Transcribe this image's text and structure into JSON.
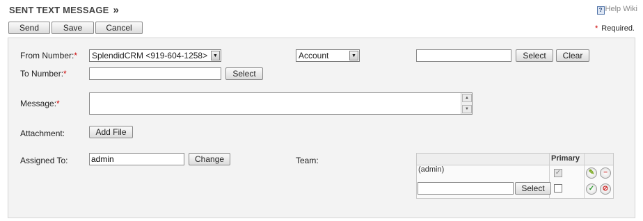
{
  "header": {
    "title": "SENT TEXT MESSAGE",
    "chevron": "»",
    "help_label": "Help Wiki",
    "help_icon": "?"
  },
  "toolbar": {
    "send_label": "Send",
    "save_label": "Save",
    "cancel_label": "Cancel"
  },
  "required_note": {
    "star": "*",
    "text": "Required."
  },
  "form": {
    "from_number": {
      "label": "From Number:",
      "star": "*",
      "value": "SplendidCRM <919-604-1258>"
    },
    "parent": {
      "type_value": "Account",
      "name_value": "",
      "select_label": "Select",
      "clear_label": "Clear"
    },
    "to_number": {
      "label": "To Number:",
      "star": "*",
      "value": "",
      "select_label": "Select"
    },
    "message": {
      "label": "Message:",
      "star": "*",
      "value": ""
    },
    "attachment": {
      "label": "Attachment:",
      "add_file_label": "Add File"
    },
    "assigned_to": {
      "label": "Assigned To:",
      "value": "admin",
      "change_label": "Change"
    },
    "team": {
      "label": "Team:",
      "primary_header": "Primary",
      "rows": [
        {
          "name": "(admin)",
          "primary": true
        }
      ],
      "new_row": {
        "value": "",
        "select_label": "Select"
      }
    }
  },
  "colors": {
    "required_star": "#cc0000",
    "panel_bg": "#f3f3f3",
    "edit_icon": "#7aa81e",
    "remove_icon": "#cc2222",
    "accept_icon": "#2e9a2e",
    "cancel_icon": "#cc2222"
  }
}
